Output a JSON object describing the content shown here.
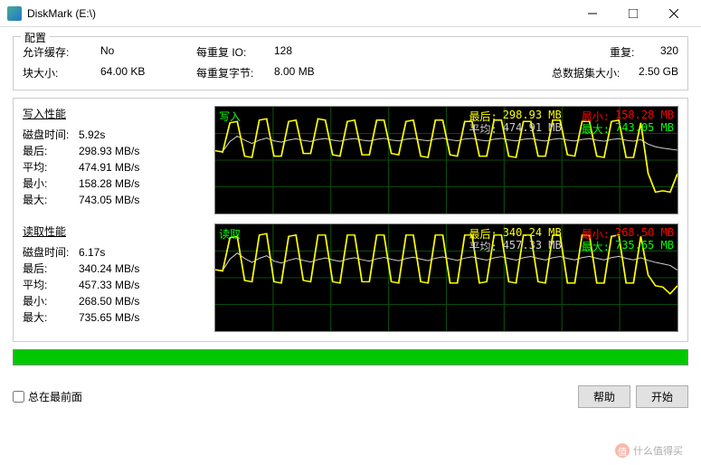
{
  "window": {
    "title": "DiskMark (E:\\)"
  },
  "config": {
    "title": "配置",
    "allow_cache_label": "允许缓存:",
    "allow_cache": "No",
    "io_per_rep_label": "每重复 IO:",
    "io_per_rep": "128",
    "repeat_label": "重复:",
    "repeat": "320",
    "block_size_label": "块大小:",
    "block_size": "64.00 KB",
    "bytes_per_rep_label": "每重复字节:",
    "bytes_per_rep": "8.00 MB",
    "total_size_label": "总数据集大小:",
    "total_size": "2.50 GB"
  },
  "write": {
    "title": "写入性能",
    "disk_time_label": "磁盘时间:",
    "disk_time": "5.92s",
    "last_label": "最后:",
    "last": "298.93 MB/s",
    "avg_label": "平均:",
    "avg": "474.91 MB/s",
    "min_label": "最小:",
    "min": "158.28 MB/s",
    "max_label": "最大:",
    "max": "743.05 MB/s",
    "chart": {
      "name": "写入",
      "last_l": "最后:",
      "last_v": "298.93 MB",
      "avg_l": "平均:",
      "avg_v": "474.91 MB",
      "min_l": "最小:",
      "min_v": "158.28 MB",
      "max_l": "最大:",
      "max_v": "743.05 MB"
    }
  },
  "read": {
    "title": "读取性能",
    "disk_time_label": "磁盘时间:",
    "disk_time": "6.17s",
    "last_label": "最后:",
    "last": "340.24 MB/s",
    "avg_label": "平均:",
    "avg": "457.33 MB/s",
    "min_label": "最小:",
    "min": "268.50 MB/s",
    "max_label": "最大:",
    "max": "735.65 MB/s",
    "chart": {
      "name": "读取",
      "last_l": "最后:",
      "last_v": "340.24 MB",
      "avg_l": "平均:",
      "avg_v": "457.33 MB",
      "min_l": "最小:",
      "min_v": "268.50 MB",
      "max_l": "最大:",
      "max_v": "735.65 MB"
    }
  },
  "footer": {
    "always_top": "总在最前面",
    "help": "帮助",
    "start": "开始"
  },
  "watermark": "什么值得买",
  "chart_data": [
    {
      "type": "line",
      "title": "写入",
      "ylim": [
        0,
        800
      ],
      "ylabel": "MB/s",
      "series": [
        {
          "name": "value",
          "values": [
            470,
            460,
            680,
            690,
            430,
            420,
            700,
            710,
            430,
            430,
            690,
            700,
            450,
            450,
            710,
            700,
            440,
            430,
            690,
            700,
            440,
            440,
            700,
            700,
            450,
            440,
            690,
            700,
            430,
            420,
            700,
            700,
            440,
            430,
            690,
            690,
            430,
            430,
            700,
            700,
            430,
            420,
            690,
            690,
            430,
            430,
            700,
            700,
            440,
            430,
            690,
            690,
            430,
            420,
            690,
            700,
            420,
            420,
            680,
            300,
            160,
            170,
            160,
            298
          ]
        },
        {
          "name": "average",
          "values": [
            470,
            465,
            540,
            580,
            550,
            525,
            550,
            565,
            545,
            535,
            550,
            560,
            548,
            540,
            555,
            562,
            550,
            542,
            555,
            562,
            550,
            543,
            556,
            563,
            551,
            544,
            557,
            563,
            552,
            545,
            558,
            564,
            552,
            545,
            558,
            563,
            551,
            544,
            557,
            563,
            551,
            544,
            556,
            562,
            550,
            543,
            556,
            562,
            550,
            543,
            555,
            561,
            549,
            542,
            554,
            561,
            549,
            542,
            553,
            520,
            500,
            490,
            482,
            475
          ]
        }
      ]
    },
    {
      "type": "line",
      "title": "读取",
      "ylim": [
        0,
        800
      ],
      "ylabel": "MB/s",
      "series": [
        {
          "name": "value",
          "values": [
            460,
            450,
            700,
            710,
            380,
            370,
            720,
            730,
            370,
            360,
            710,
            720,
            380,
            370,
            720,
            720,
            370,
            360,
            720,
            720,
            370,
            370,
            720,
            720,
            370,
            360,
            720,
            720,
            370,
            360,
            720,
            720,
            360,
            360,
            720,
            720,
            360,
            370,
            720,
            720,
            370,
            360,
            720,
            720,
            370,
            360,
            720,
            720,
            360,
            360,
            720,
            720,
            360,
            360,
            710,
            720,
            360,
            360,
            710,
            420,
            340,
            330,
            280,
            340
          ]
        },
        {
          "name": "average",
          "values": [
            460,
            455,
            540,
            585,
            545,
            515,
            545,
            565,
            525,
            510,
            530,
            545,
            530,
            518,
            536,
            548,
            534,
            522,
            540,
            550,
            535,
            524,
            542,
            552,
            538,
            527,
            544,
            554,
            540,
            528,
            546,
            556,
            542,
            530,
            547,
            557,
            543,
            532,
            549,
            558,
            544,
            532,
            550,
            559,
            545,
            533,
            550,
            559,
            545,
            534,
            551,
            560,
            546,
            534,
            551,
            560,
            545,
            534,
            550,
            530,
            515,
            504,
            492,
            457
          ]
        }
      ]
    }
  ]
}
